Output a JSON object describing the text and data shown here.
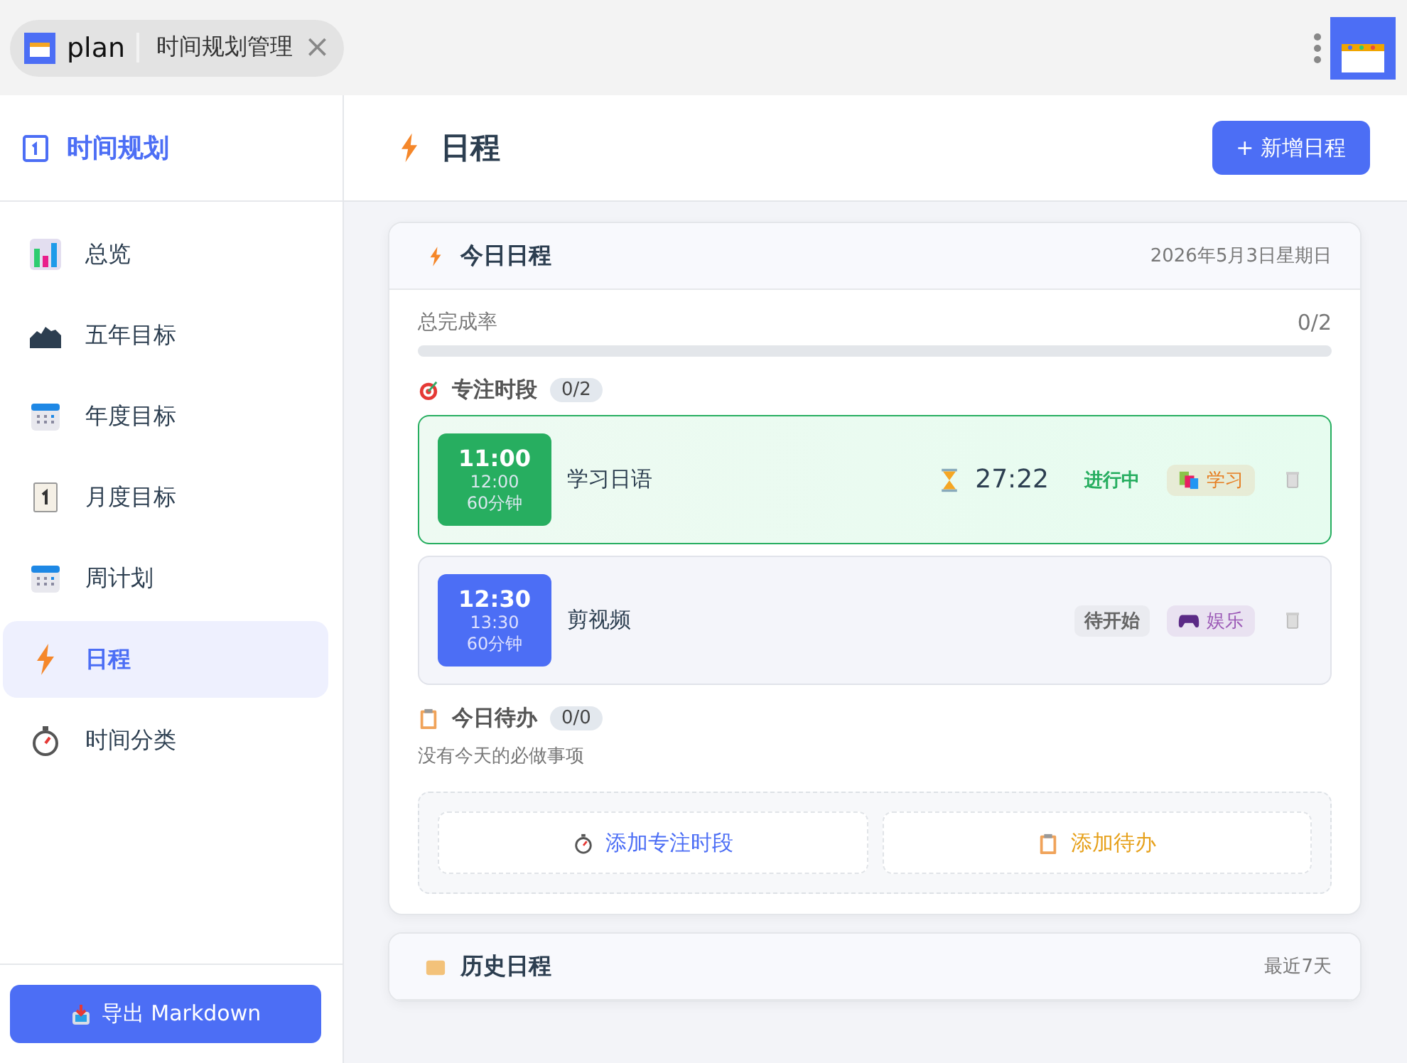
{
  "browser_tab": {
    "app_name": "plan",
    "page_title": "时间规划管理",
    "close": "×"
  },
  "sidebar": {
    "title": "时间规划",
    "items": [
      {
        "label": "总览",
        "selected": false
      },
      {
        "label": "五年目标",
        "selected": false
      },
      {
        "label": "年度目标",
        "selected": false
      },
      {
        "label": "月度目标",
        "selected": false
      },
      {
        "label": "周计划",
        "selected": false
      },
      {
        "label": "日程",
        "selected": true
      },
      {
        "label": "时间分类",
        "selected": false
      }
    ],
    "export_button": "导出 Markdown"
  },
  "header": {
    "title": "日程",
    "add_button": "+ 新增日程"
  },
  "today": {
    "title": "今日日程",
    "date": "2026年5月3日星期日",
    "completion_label": "总完成率",
    "completion_value": "0/2",
    "level": 0,
    "focus": {
      "title": "专注时段",
      "count": "0/2",
      "sessions": [
        {
          "start": "11:00",
          "end": "12:00",
          "duration": "60分钟",
          "name": "学习日语",
          "kind": "active",
          "timer": "27:22",
          "status_label": "进行中",
          "category": {
            "label": "学习",
            "color": "#e67e22"
          }
        },
        {
          "start": "12:30",
          "end": "13:30",
          "duration": "60分钟",
          "name": "剪视频",
          "kind": "pending",
          "status_label": "待开始",
          "category": {
            "label": "娱乐",
            "color": "#9b59b6"
          }
        }
      ]
    },
    "todos": {
      "title": "今日待办",
      "count": "0/0",
      "empty": "没有今天的必做事项"
    },
    "actions": [
      "添加专注时段",
      "添加待办"
    ]
  },
  "history": {
    "title": "历史日程",
    "range": "最近7天"
  }
}
